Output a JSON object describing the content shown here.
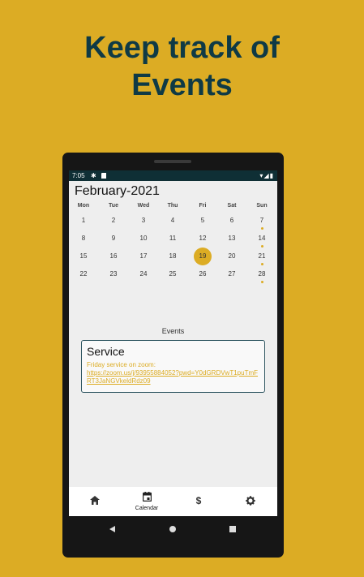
{
  "headline": {
    "line1": "Keep track of",
    "line2": "Events"
  },
  "status_bar": {
    "time": "7:05"
  },
  "calendar": {
    "month_title": "February-2021",
    "weekdays": [
      "Mon",
      "Tue",
      "Wed",
      "Thu",
      "Fri",
      "Sat",
      "Sun"
    ],
    "weeks": [
      [
        "1",
        "2",
        "3",
        "4",
        "5",
        "6",
        "7"
      ],
      [
        "8",
        "9",
        "10",
        "11",
        "12",
        "13",
        "14"
      ],
      [
        "15",
        "16",
        "17",
        "18",
        "19",
        "20",
        "21"
      ],
      [
        "22",
        "23",
        "24",
        "25",
        "26",
        "27",
        "28"
      ]
    ],
    "selected_day": "19",
    "days_with_events": [
      "7",
      "14",
      "21",
      "28"
    ],
    "accent_color": "#DCAC24"
  },
  "events": {
    "label": "Events",
    "items": [
      {
        "title": "Service",
        "description": "Friday service on  zoom:",
        "link": "https://zoom.us/j/93955884052?pwd=Y0dGRDVwT1puTmFRT3JaNGVkeldRdz09"
      }
    ]
  },
  "bottom_nav": {
    "items": [
      {
        "name": "home",
        "icon": "home-icon",
        "label": ""
      },
      {
        "name": "calendar",
        "icon": "calendar-icon",
        "label": "Calendar"
      },
      {
        "name": "donate",
        "icon": "dollar-icon",
        "label": ""
      },
      {
        "name": "settings",
        "icon": "gear-icon",
        "label": ""
      }
    ],
    "active": "calendar"
  }
}
